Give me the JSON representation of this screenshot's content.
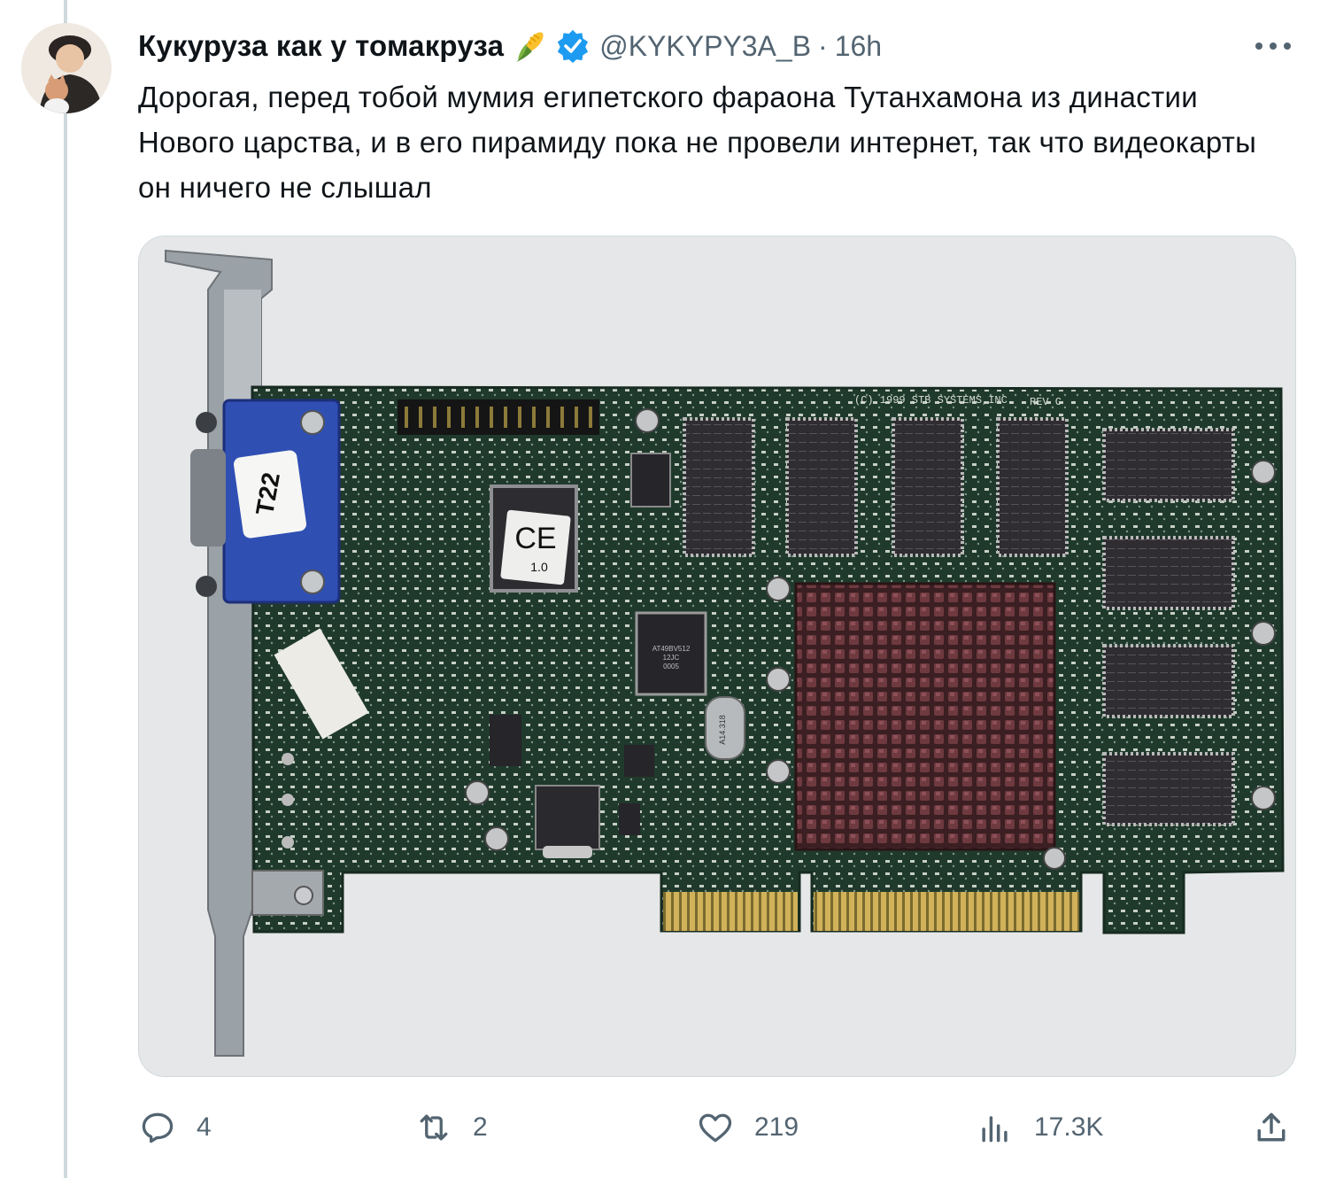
{
  "tweet": {
    "display_name": "Кукуруза как у томакруза",
    "name_emoji": "corn-emoji",
    "verified": true,
    "handle": "@KYKYPY3A_B",
    "separator": "·",
    "time": "16h",
    "text": "Дорогая, перед тобой мумия египетского фараона Тутанхамона из династии Нового царства, и в его пирамиду пока не провели интернет, так что видеокарты он ничего не слышал"
  },
  "media": {
    "board_copyright": "(C) 1999 STB SYSTEMS,INC.",
    "board_rev": "REV C",
    "sticker_label": "T22",
    "ce_mark": "CE",
    "ce_version": "1.0",
    "chip_label": "AT49BV512",
    "chip_code": "12JC",
    "chip_date": "0005",
    "crystal_label": "A14.318"
  },
  "actions": {
    "replies": "4",
    "reposts": "2",
    "likes": "219",
    "views": "17.3K"
  },
  "colors": {
    "text": "#0f1419",
    "secondary": "#536471",
    "verified_blue": "#1d9bf0",
    "pcb_green": "#1f3a2c",
    "thread_line": "#cfd9de"
  }
}
